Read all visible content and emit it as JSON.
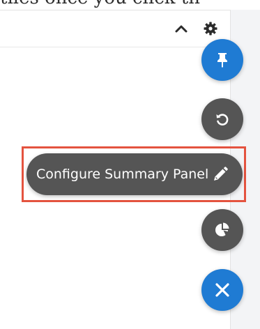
{
  "background_text": "tiles once you click th",
  "panel": {
    "collapse_icon": "chevron-up-icon",
    "settings_icon": "gear-icon"
  },
  "fab_menu": {
    "pin_icon": "pin-icon",
    "reset_icon": "reset-icon",
    "configure_label": "Configure Summary Panel",
    "configure_icon": "pencil-icon",
    "chart_icon": "pie-chart-icon",
    "close_icon": "close-icon"
  },
  "colors": {
    "accent_blue": "#1f7bd3",
    "dark_gray": "#555555",
    "highlight_red": "#e4533f"
  }
}
